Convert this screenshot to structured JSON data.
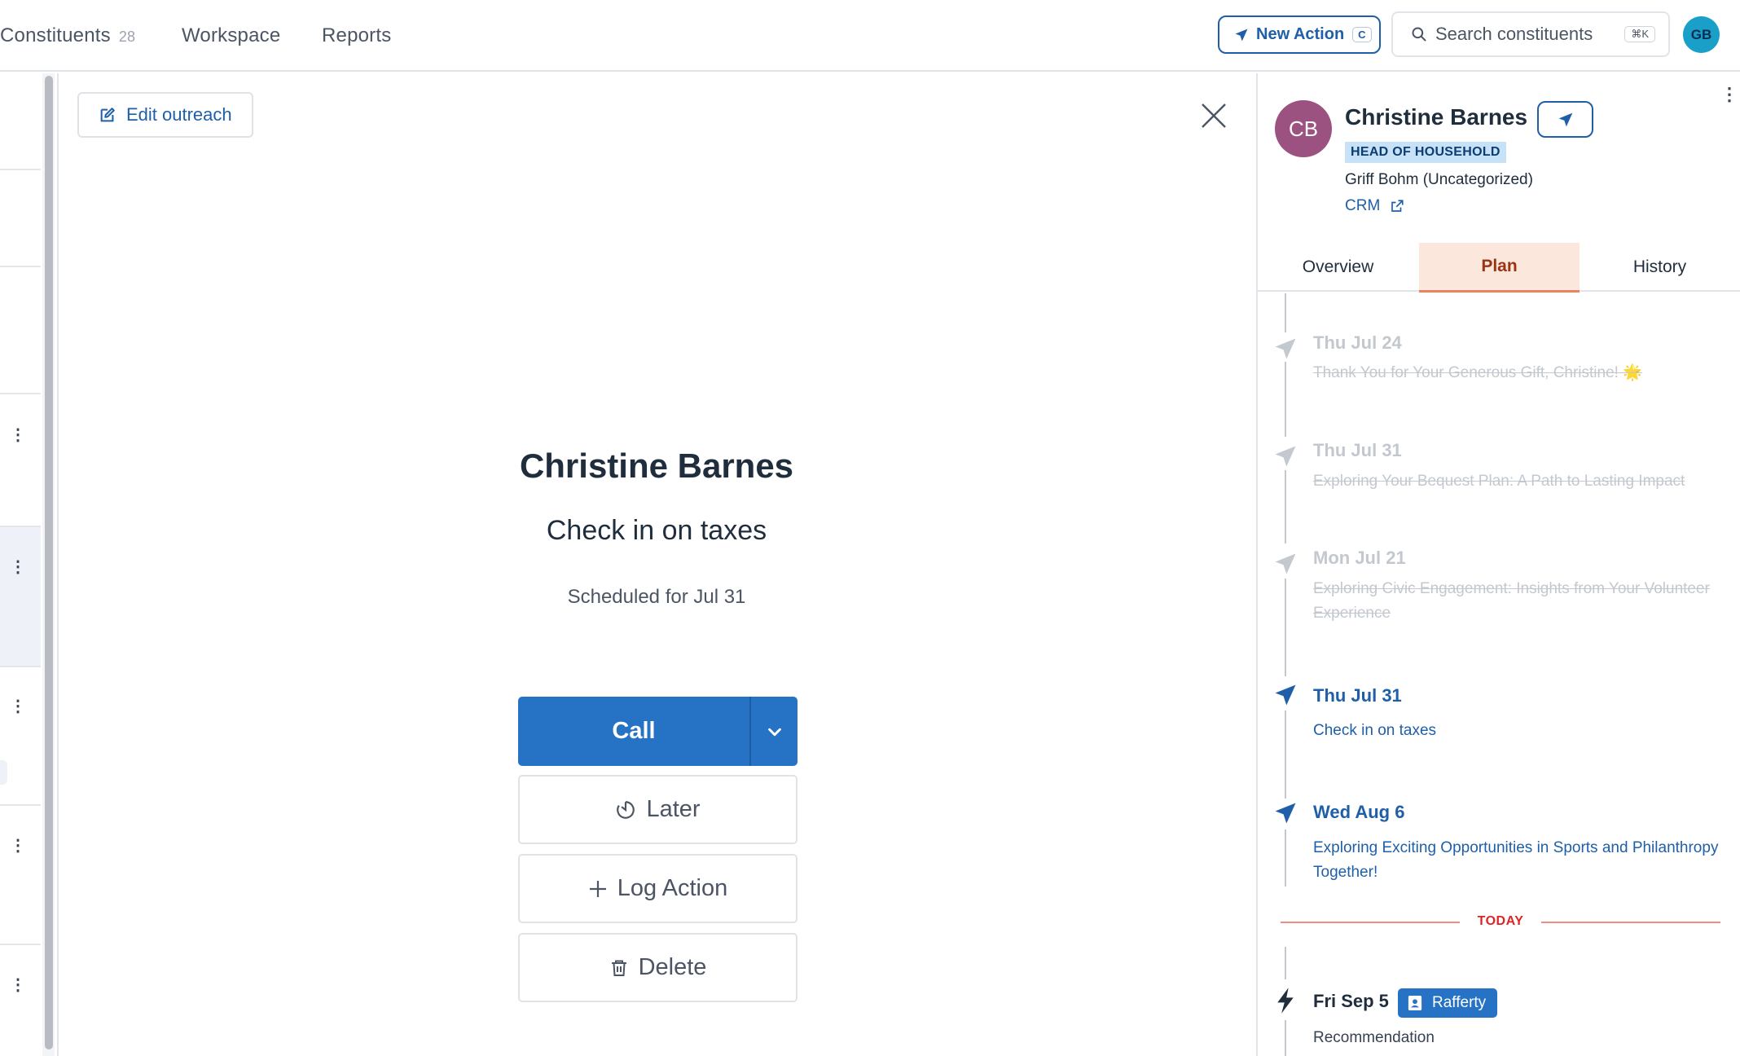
{
  "nav": {
    "constituents_label": "Constituents",
    "constituents_count": "28",
    "workspace_label": "Workspace",
    "reports_label": "Reports",
    "new_action_label": "New Action",
    "new_action_shortcut": "C",
    "search_placeholder": "Search constituents",
    "search_shortcut": "⌘K",
    "user_initials": "GB"
  },
  "outreach": {
    "edit_label": "Edit outreach",
    "name": "Christine Barnes",
    "task": "Check in on taxes",
    "scheduled": "Scheduled for Jul 31",
    "call_label": "Call",
    "later_label": "Later",
    "log_label": "Log Action",
    "delete_label": "Delete"
  },
  "profile": {
    "initials": "CB",
    "name": "Christine Barnes",
    "badge": "HEAD OF HOUSEHOLD",
    "owner": "Griff Bohm (Uncategorized)",
    "crm_label": "CRM",
    "tabs": [
      {
        "label": "Overview",
        "active": false
      },
      {
        "label": "Plan",
        "active": true
      },
      {
        "label": "History",
        "active": false
      }
    ]
  },
  "timeline": {
    "items": [
      {
        "date": "Thu Jul 24",
        "title": "Thank You for Your Generous Gift, Christine! 🌟",
        "status": "done"
      },
      {
        "date": "Thu Jul 31",
        "title": "Exploring Your Bequest Plan: A Path to Lasting Impact",
        "status": "done"
      },
      {
        "date": "Mon Jul 21",
        "title": "Exploring Civic Engagement: Insights from Your Volunteer Experience",
        "status": "done"
      },
      {
        "date": "Thu Jul 31",
        "title": "Check in on taxes",
        "status": "upcoming"
      },
      {
        "date": "Wed Aug 6",
        "title": "Exploring Exciting Opportunities in Sports and Philanthropy Together!",
        "status": "upcoming"
      },
      {
        "date": "Fri Sep 5",
        "title": "Recommendation",
        "status": "recommendation",
        "tag": "Rafferty"
      }
    ],
    "today_label": "TODAY"
  },
  "colors": {
    "primary": "#2672c5",
    "link": "#1f5fa8",
    "avatar": "#9c5280",
    "today": "#dc2626",
    "active_tab_bg": "#fce7dc"
  }
}
